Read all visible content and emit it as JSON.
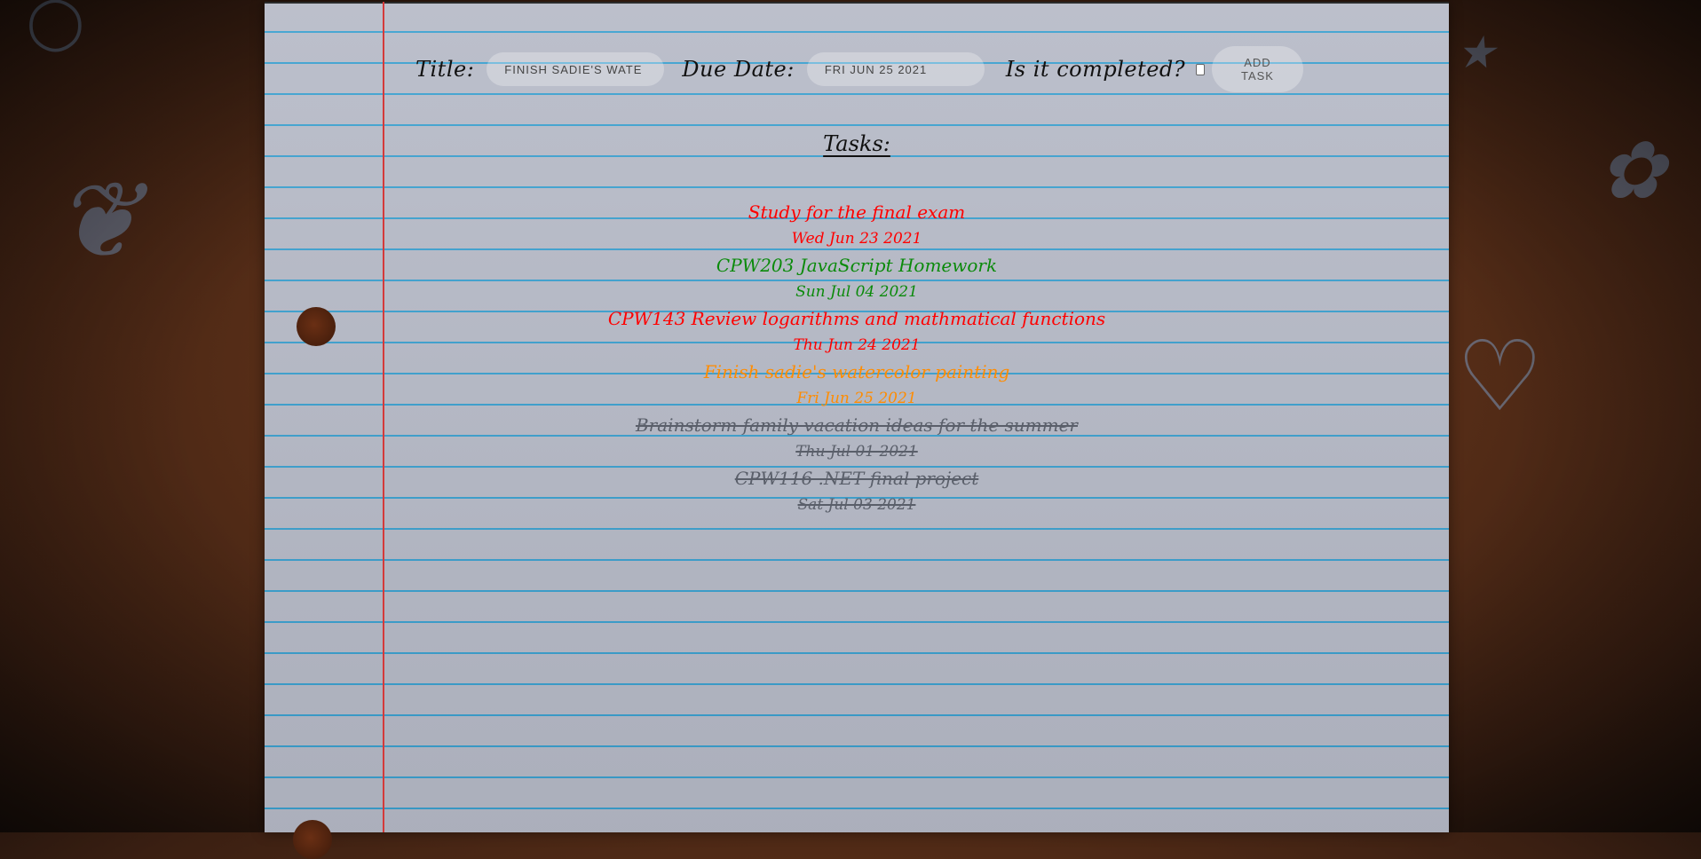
{
  "form": {
    "title_label": "Title:",
    "title_value": "FINISH SADIE'S WATE",
    "due_label": "Due Date:",
    "due_value": "FRI JUN 25 2021",
    "completed_label": "Is it completed?",
    "completed_checked": false,
    "add_button": "ADD TASK"
  },
  "tasks_heading": "Tasks:",
  "tasks": [
    {
      "title": "Study for the final exam",
      "date": "Wed Jun 23 2021",
      "color": "#ff0000",
      "completed": false
    },
    {
      "title": "CPW203 JavaScript Homework",
      "date": "Sun Jul 04 2021",
      "color": "#0a8a0a",
      "completed": false
    },
    {
      "title": "CPW143 Review logarithms and mathmatical functions",
      "date": "Thu Jun 24 2021",
      "color": "#ff0000",
      "completed": false
    },
    {
      "title": "Finish sadie's watercolor painting",
      "date": "Fri Jun 25 2021",
      "color": "#ff8c00",
      "completed": false
    },
    {
      "title": "Brainstorm family vacation ideas for the summer",
      "date": "Thu Jul 01 2021",
      "color": "#5a5f6a",
      "completed": true
    },
    {
      "title": "CPW116 .NET final project",
      "date": "Sat Jul 03 2021",
      "color": "#5a5f6a",
      "completed": true
    }
  ],
  "colors": {
    "overdue": "#ff0000",
    "upcoming": "#0a8a0a",
    "due_soon": "#ff8c00",
    "completed": "#5a5f6a",
    "rule_line": "#3aa0cf",
    "margin_line": "#d43a3a"
  }
}
